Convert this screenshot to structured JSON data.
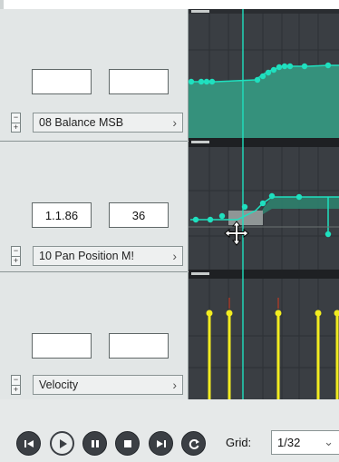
{
  "lanes": [
    {
      "field1": "",
      "field2": "",
      "selector": "08 Balance MSB"
    },
    {
      "field1": "1.1.86",
      "field2": "36",
      "selector": "10 Pan Position M!"
    },
    {
      "field1": "",
      "field2": "",
      "selector": "Velocity"
    }
  ],
  "transport": {
    "grid_label": "Grid:",
    "grid_value": "1/32"
  },
  "icons": [
    "skip-back-icon",
    "play-icon",
    "pause-icon",
    "stop-icon",
    "skip-forward-icon",
    "loop-icon",
    "move-cursor-icon"
  ],
  "colors": {
    "lane_fill": "#35917c",
    "point": "#1fe0bf",
    "velocity_stem": "#f2ec20",
    "playhead": "#1fe0bf",
    "grid_bg": "#3a3e43"
  }
}
